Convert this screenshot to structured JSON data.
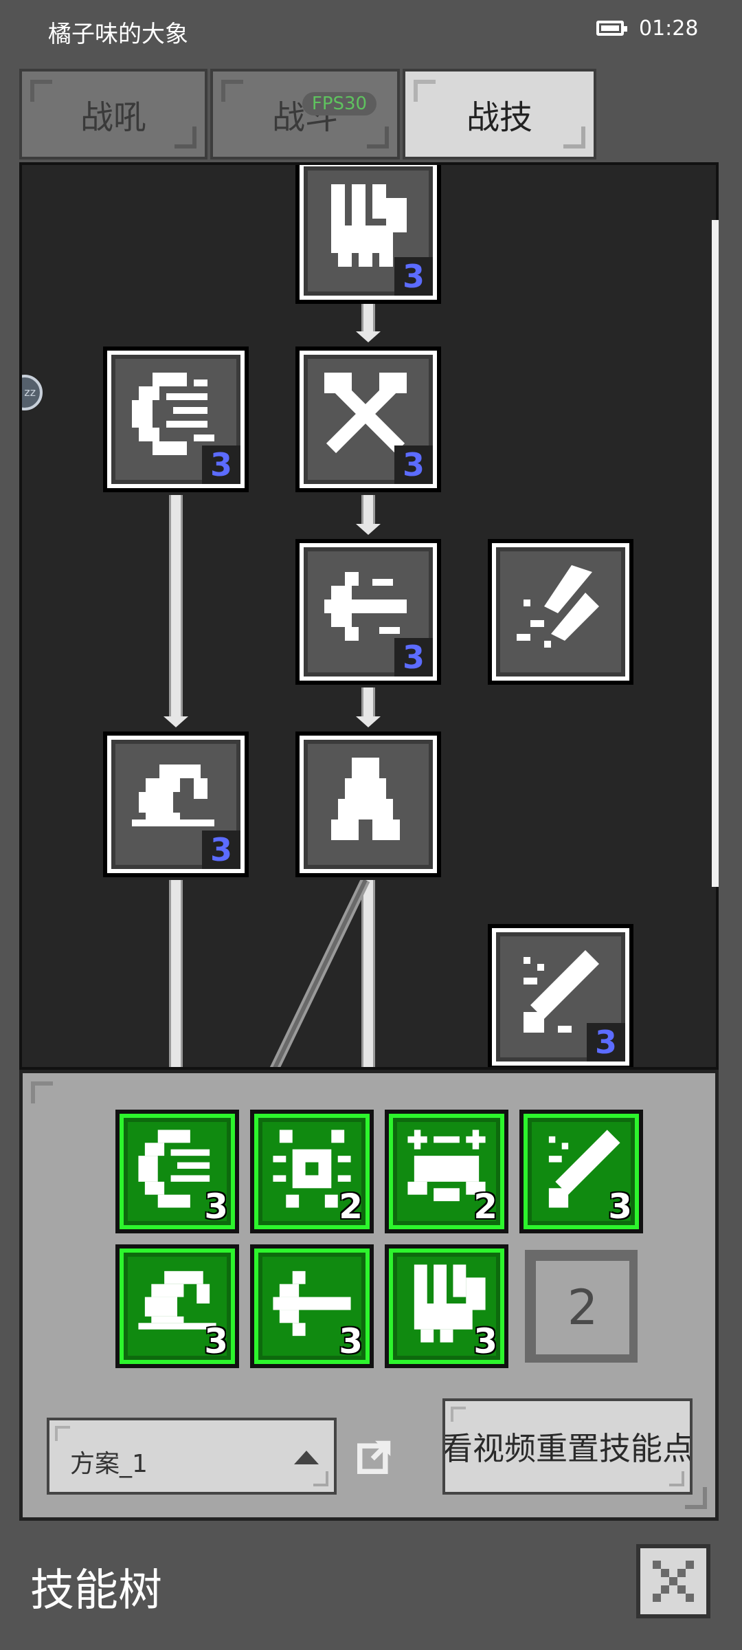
{
  "status": {
    "title": "橘子味的大象",
    "time": "01:28"
  },
  "tabs": [
    {
      "label": "战吼",
      "active": false
    },
    {
      "label": "战斗",
      "active": false
    },
    {
      "label": "战技",
      "active": true
    }
  ],
  "fps_label": "FPS30",
  "side_bubble": "zz",
  "tree_nodes": [
    {
      "icon": "fist-icon",
      "level": "3"
    },
    {
      "icon": "wind-gust-icon",
      "level": "3"
    },
    {
      "icon": "crossed-swords-icon",
      "level": "3"
    },
    {
      "icon": "dash-arrow-icon",
      "level": "3"
    },
    {
      "icon": "twin-blades-icon",
      "level": ""
    },
    {
      "icon": "whirl-slash-icon",
      "level": "3"
    },
    {
      "icon": "hooded-warrior-icon",
      "level": ""
    },
    {
      "icon": "great-sword-icon",
      "level": "3"
    }
  ],
  "equipped_skills": [
    {
      "icon": "wind-gust-icon",
      "count": "3"
    },
    {
      "icon": "beetle-icon",
      "count": "2"
    },
    {
      "icon": "crab-icon",
      "count": "2"
    },
    {
      "icon": "great-sword-icon",
      "count": "3"
    },
    {
      "icon": "whirl-slash-icon",
      "count": "3"
    },
    {
      "icon": "dash-arrow-icon",
      "count": "3"
    },
    {
      "icon": "fist-icon",
      "count": "3"
    }
  ],
  "skill_points": "2",
  "plan": {
    "label": "方案_1"
  },
  "reset_button": "看视频重置技能点",
  "footer": {
    "title": "技能树"
  },
  "colors": {
    "badge_text": "#5c6cff",
    "equipped_border": "#2df52d",
    "equipped_bg": "#108a10"
  }
}
